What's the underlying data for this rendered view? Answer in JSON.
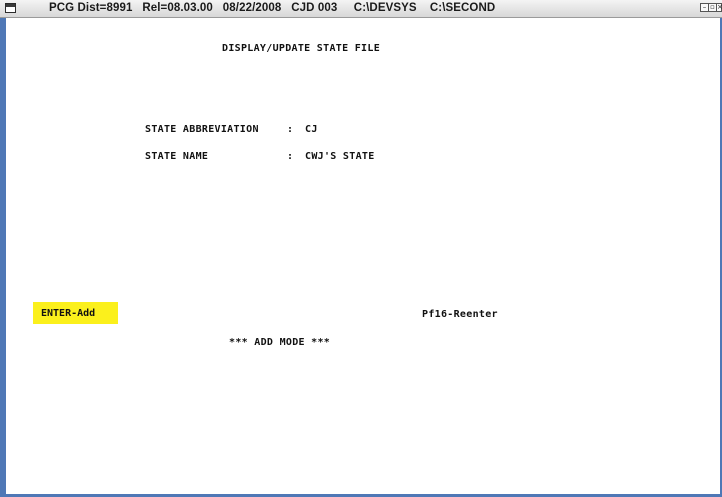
{
  "titlebar": {
    "title": "PCG Dist=8991   Rel=08.03.00   08/22/2008   CJD 003     C:\\DEVSYS    C:\\SECOND"
  },
  "screen": {
    "heading": "DISPLAY/UPDATE STATE FILE",
    "fields": [
      {
        "label": "STATE ABBREVIATION",
        "separator": ":",
        "value": "CJ"
      },
      {
        "label": "STATE NAME",
        "separator": ":",
        "value": "CWJ'S STATE"
      }
    ],
    "function_keys": {
      "enter": "ENTER-Add",
      "pf16": "Pf16-Reenter"
    },
    "mode": "*** ADD MODE ***"
  },
  "colors": {
    "frame": "#4f78b6",
    "highlight": "#fbf01c"
  }
}
